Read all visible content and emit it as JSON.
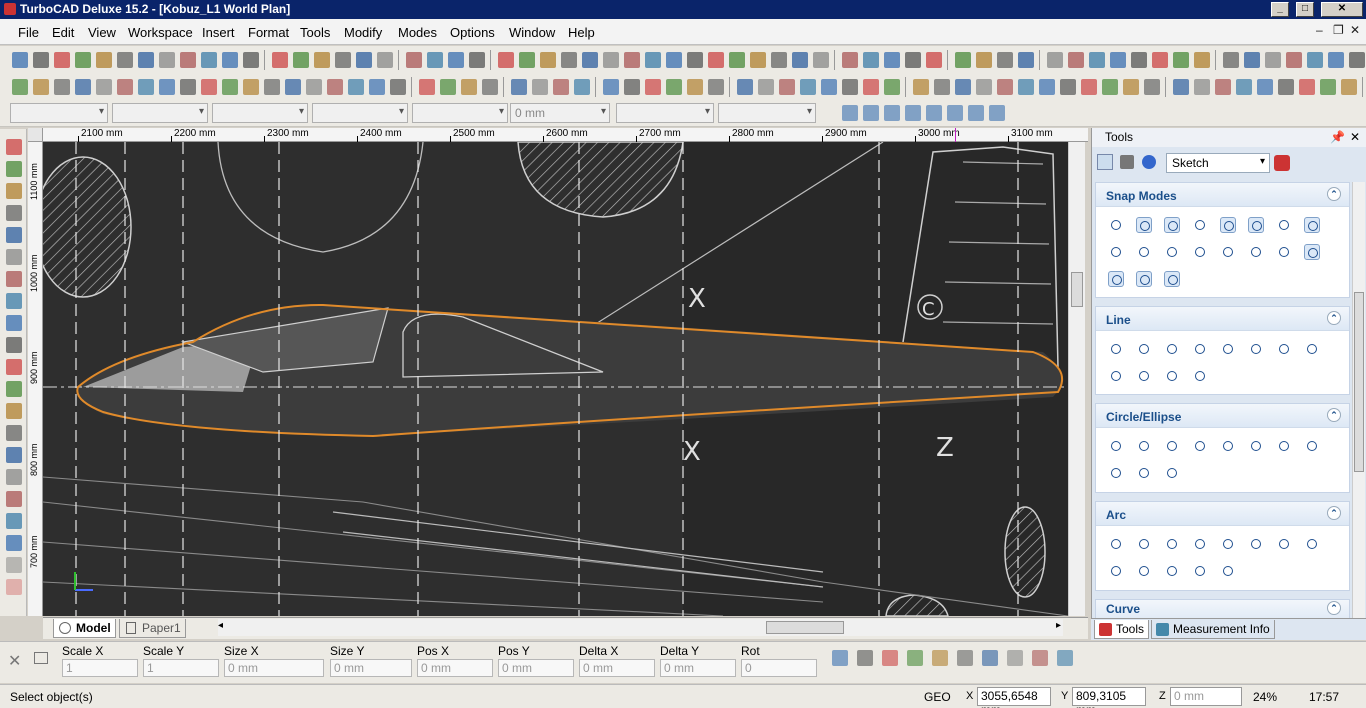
{
  "window": {
    "title": "TurboCAD Deluxe 15.2 - [Kobuz_L1 World Plan]"
  },
  "menu": [
    "File",
    "Edit",
    "View",
    "Workspace",
    "Insert",
    "Format",
    "Tools",
    "Modify",
    "Modes",
    "Options",
    "Window",
    "Help"
  ],
  "toolbar3": {
    "value_field": "0 mm"
  },
  "ruler": {
    "h_labels": [
      "2100 mm",
      "2200 mm",
      "2300 mm",
      "2400 mm",
      "2500 mm",
      "2600 mm",
      "2700 mm",
      "2800 mm",
      "2900 mm",
      "3000 mm",
      "3100 mm"
    ],
    "v_labels": [
      "1100 mm",
      "1000 mm",
      "900 mm",
      "800 mm",
      "700 mm"
    ]
  },
  "drawing": {
    "annotations": [
      "X",
      "X",
      "Z",
      "C"
    ]
  },
  "tabs": {
    "model": "Model",
    "paper": "Paper1"
  },
  "panel": {
    "title": "Tools",
    "mode": "Sketch",
    "sections": [
      "Snap Modes",
      "Line",
      "Circle/Ellipse",
      "Arc",
      "Curve"
    ],
    "bottom_tabs": [
      "Tools",
      "Measurement Info"
    ]
  },
  "inspector": {
    "fields": [
      {
        "label": "Scale X",
        "value": "1"
      },
      {
        "label": "Scale Y",
        "value": "1"
      },
      {
        "label": "Size X",
        "value": "0 mm"
      },
      {
        "label": "Size Y",
        "value": "0 mm"
      },
      {
        "label": "Pos X",
        "value": "0 mm"
      },
      {
        "label": "Pos Y",
        "value": "0 mm"
      },
      {
        "label": "Delta X",
        "value": "0 mm"
      },
      {
        "label": "Delta Y",
        "value": "0 mm"
      },
      {
        "label": "Rot",
        "value": "0"
      }
    ]
  },
  "status": {
    "prompt": "Select object(s)",
    "geo": "GEO",
    "x": "3055,6548 mm",
    "y": "809,3105 mm",
    "z": "0 mm",
    "zoom": "24%",
    "time": "17:57"
  }
}
